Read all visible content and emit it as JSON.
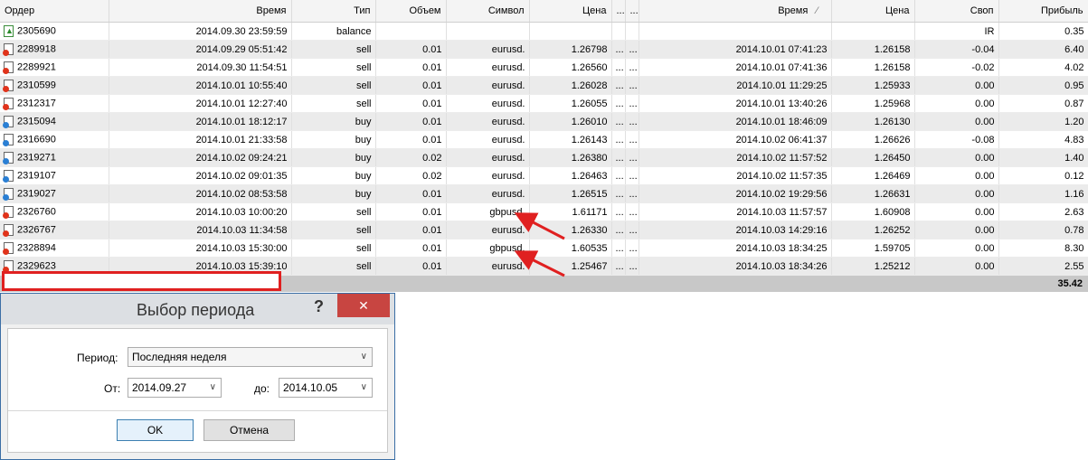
{
  "columns": [
    "Ордер",
    "Время",
    "Тип",
    "Объем",
    "Символ",
    "Цена",
    "...",
    "...",
    "Время",
    "Цена",
    "Своп",
    "Прибыль"
  ],
  "sort_indicator": "⁄",
  "rows": [
    {
      "order": "2305690",
      "time": "2014.09.30 23:59:59",
      "type": "balance",
      "volume": "",
      "symbol": "",
      "price": "",
      "d1": "",
      "d2": "",
      "close_time": "",
      "close_price": "",
      "swap": "IR",
      "profit": "0.35",
      "icon": "balance"
    },
    {
      "order": "2289918",
      "time": "2014.09.29 05:51:42",
      "type": "sell",
      "volume": "0.01",
      "symbol": "eurusd.",
      "price": "1.26798",
      "d1": "...",
      "d2": "...",
      "close_time": "2014.10.01 07:41:23",
      "close_price": "1.26158",
      "swap": "-0.04",
      "profit": "6.40",
      "icon": "sell"
    },
    {
      "order": "2289921",
      "time": "2014.09.30 11:54:51",
      "type": "sell",
      "volume": "0.01",
      "symbol": "eurusd.",
      "price": "1.26560",
      "d1": "...",
      "d2": "...",
      "close_time": "2014.10.01 07:41:36",
      "close_price": "1.26158",
      "swap": "-0.02",
      "profit": "4.02",
      "icon": "sell"
    },
    {
      "order": "2310599",
      "time": "2014.10.01 10:55:40",
      "type": "sell",
      "volume": "0.01",
      "symbol": "eurusd.",
      "price": "1.26028",
      "d1": "...",
      "d2": "...",
      "close_time": "2014.10.01 11:29:25",
      "close_price": "1.25933",
      "swap": "0.00",
      "profit": "0.95",
      "icon": "sell"
    },
    {
      "order": "2312317",
      "time": "2014.10.01 12:27:40",
      "type": "sell",
      "volume": "0.01",
      "symbol": "eurusd.",
      "price": "1.26055",
      "d1": "...",
      "d2": "...",
      "close_time": "2014.10.01 13:40:26",
      "close_price": "1.25968",
      "swap": "0.00",
      "profit": "0.87",
      "icon": "sell"
    },
    {
      "order": "2315094",
      "time": "2014.10.01 18:12:17",
      "type": "buy",
      "volume": "0.01",
      "symbol": "eurusd.",
      "price": "1.26010",
      "d1": "...",
      "d2": "...",
      "close_time": "2014.10.01 18:46:09",
      "close_price": "1.26130",
      "swap": "0.00",
      "profit": "1.20",
      "icon": "buy"
    },
    {
      "order": "2316690",
      "time": "2014.10.01 21:33:58",
      "type": "buy",
      "volume": "0.01",
      "symbol": "eurusd.",
      "price": "1.26143",
      "d1": "...",
      "d2": "...",
      "close_time": "2014.10.02 06:41:37",
      "close_price": "1.26626",
      "swap": "-0.08",
      "profit": "4.83",
      "icon": "buy"
    },
    {
      "order": "2319271",
      "time": "2014.10.02 09:24:21",
      "type": "buy",
      "volume": "0.02",
      "symbol": "eurusd.",
      "price": "1.26380",
      "d1": "...",
      "d2": "...",
      "close_time": "2014.10.02 11:57:52",
      "close_price": "1.26450",
      "swap": "0.00",
      "profit": "1.40",
      "icon": "buy"
    },
    {
      "order": "2319107",
      "time": "2014.10.02 09:01:35",
      "type": "buy",
      "volume": "0.02",
      "symbol": "eurusd.",
      "price": "1.26463",
      "d1": "...",
      "d2": "...",
      "close_time": "2014.10.02 11:57:35",
      "close_price": "1.26469",
      "swap": "0.00",
      "profit": "0.12",
      "icon": "buy"
    },
    {
      "order": "2319027",
      "time": "2014.10.02 08:53:58",
      "type": "buy",
      "volume": "0.01",
      "symbol": "eurusd.",
      "price": "1.26515",
      "d1": "...",
      "d2": "...",
      "close_time": "2014.10.02 19:29:56",
      "close_price": "1.26631",
      "swap": "0.00",
      "profit": "1.16",
      "icon": "buy"
    },
    {
      "order": "2326760",
      "time": "2014.10.03 10:00:20",
      "type": "sell",
      "volume": "0.01",
      "symbol": "gbpusd.",
      "price": "1.61171",
      "d1": "...",
      "d2": "...",
      "close_time": "2014.10.03 11:57:57",
      "close_price": "1.60908",
      "swap": "0.00",
      "profit": "2.63",
      "icon": "sell"
    },
    {
      "order": "2326767",
      "time": "2014.10.03 11:34:58",
      "type": "sell",
      "volume": "0.01",
      "symbol": "eurusd.",
      "price": "1.26330",
      "d1": "...",
      "d2": "...",
      "close_time": "2014.10.03 14:29:16",
      "close_price": "1.26252",
      "swap": "0.00",
      "profit": "0.78",
      "icon": "sell"
    },
    {
      "order": "2328894",
      "time": "2014.10.03 15:30:00",
      "type": "sell",
      "volume": "0.01",
      "symbol": "gbpusd.",
      "price": "1.60535",
      "d1": "...",
      "d2": "...",
      "close_time": "2014.10.03 18:34:25",
      "close_price": "1.59705",
      "swap": "0.00",
      "profit": "8.30",
      "icon": "sell"
    },
    {
      "order": "2329623",
      "time": "2014.10.03 15:39:10",
      "type": "sell",
      "volume": "0.01",
      "symbol": "eurusd.",
      "price": "1.25467",
      "d1": "...",
      "d2": "...",
      "close_time": "2014.10.03 18:34:26",
      "close_price": "1.25212",
      "swap": "0.00",
      "profit": "2.55",
      "icon": "sell"
    }
  ],
  "total_profit": "35.42",
  "dialog": {
    "title": "Выбор периода",
    "help": "?",
    "close": "✕",
    "period_label": "Период:",
    "period_value": "Последняя неделя",
    "from_label": "От:",
    "from_value": "2014.09.27",
    "to_label": "до:",
    "to_value": "2014.10.05",
    "ok_label": "OK",
    "cancel_label": "Отмена"
  },
  "colors": {
    "annotation_red": "#e02020"
  }
}
